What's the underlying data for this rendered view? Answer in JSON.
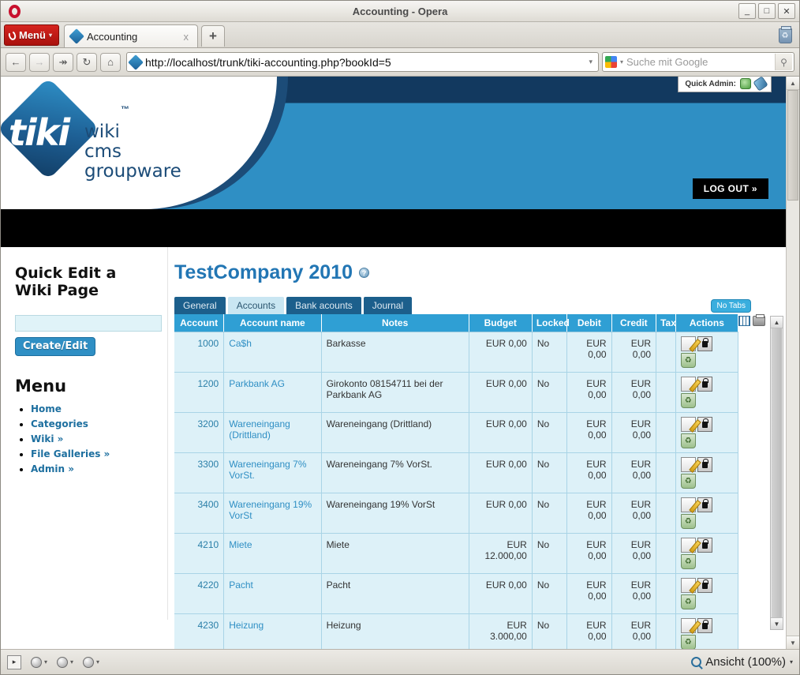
{
  "window": {
    "title": "Accounting - Opera",
    "minimize": "_",
    "maximize": "□",
    "close": "✕"
  },
  "browser": {
    "menu_label": "Menü",
    "tab": {
      "title": "Accounting",
      "close": "x"
    },
    "new_tab": "+",
    "nav": {
      "back": "←",
      "forward": "→",
      "fastforward": "↠",
      "reload": "↻",
      "home": "⌂"
    },
    "url": "http://localhost/trunk/tiki-accounting.php?bookId=5",
    "url_dropdown": "▾",
    "search_placeholder": "Suche mit Google",
    "search_button": "⚲"
  },
  "statusbar": {
    "panel_toggle": "▸",
    "buttons": [
      "images-dropdown",
      "style-dropdown",
      "settings-dropdown"
    ],
    "zoom_label": "Ansicht (100%)",
    "zoom_caret": "▾"
  },
  "banner": {
    "logo_word": "tiki",
    "logo_tm": "™",
    "logo_lines": [
      "wiki",
      "cms",
      "groupware"
    ],
    "logout": "LOG OUT »",
    "quick_admin_label": "Quick Admin:"
  },
  "sidebar": {
    "quick_edit_heading": "Quick Edit a Wiki Page",
    "quick_edit_value": "",
    "create_edit_label": "Create/Edit",
    "menu_heading": "Menu",
    "menu_items": [
      {
        "label": "Home"
      },
      {
        "label": "Categories"
      },
      {
        "label": "Wiki »"
      },
      {
        "label": "File Galleries »"
      },
      {
        "label": "Admin »"
      }
    ]
  },
  "main": {
    "page_title": "TestCompany 2010",
    "help_icon": "?",
    "tabs": [
      {
        "label": "General",
        "active": false
      },
      {
        "label": "Accounts",
        "active": true
      },
      {
        "label": "Bank acounts",
        "active": false
      },
      {
        "label": "Journal",
        "active": false
      }
    ],
    "no_tabs_label": "No Tabs",
    "table": {
      "columns": [
        "Account",
        "Account name",
        "Notes",
        "Budget",
        "Locked",
        "Debit",
        "Credit",
        "Tax",
        "Actions"
      ],
      "rows": [
        {
          "account": "1000",
          "name": "Ca$h",
          "notes": "Barkasse",
          "budget": "EUR 0,00",
          "locked": "No",
          "debit": "EUR 0,00",
          "credit": "EUR 0,00",
          "tax": ""
        },
        {
          "account": "1200",
          "name": "Parkbank AG",
          "notes": "Girokonto 08154711 bei der Parkbank AG",
          "budget": "EUR 0,00",
          "locked": "No",
          "debit": "EUR 0,00",
          "credit": "EUR 0,00",
          "tax": ""
        },
        {
          "account": "3200",
          "name": "Wareneingang (Drittland)",
          "notes": "Wareneingang (Drittland)",
          "budget": "EUR 0,00",
          "locked": "No",
          "debit": "EUR 0,00",
          "credit": "EUR 0,00",
          "tax": ""
        },
        {
          "account": "3300",
          "name": "Wareneingang 7% VorSt.",
          "notes": "Wareneingang 7% VorSt.",
          "budget": "EUR 0,00",
          "locked": "No",
          "debit": "EUR 0,00",
          "credit": "EUR 0,00",
          "tax": ""
        },
        {
          "account": "3400",
          "name": "Wareneingang 19% VorSt",
          "notes": "Wareneingang 19% VorSt",
          "budget": "EUR 0,00",
          "locked": "No",
          "debit": "EUR 0,00",
          "credit": "EUR 0,00",
          "tax": ""
        },
        {
          "account": "4210",
          "name": "Miete",
          "notes": "Miete",
          "budget": "EUR 12.000,00",
          "locked": "No",
          "debit": "EUR 0,00",
          "credit": "EUR 0,00",
          "tax": ""
        },
        {
          "account": "4220",
          "name": "Pacht",
          "notes": "Pacht",
          "budget": "EUR 0,00",
          "locked": "No",
          "debit": "EUR 0,00",
          "credit": "EUR 0,00",
          "tax": ""
        },
        {
          "account": "4230",
          "name": "Heizung",
          "notes": "Heizung",
          "budget": "EUR 3.000,00",
          "locked": "No",
          "debit": "EUR 0,00",
          "credit": "EUR 0,00",
          "tax": ""
        }
      ]
    }
  },
  "colors": {
    "tiki_blue": "#2f9fd4",
    "tiki_dark_blue": "#1c5f8c",
    "table_row": "#ddf1f8",
    "link": "#2f8fc4",
    "title": "#2276b4",
    "opera_red": "#c8102e"
  }
}
